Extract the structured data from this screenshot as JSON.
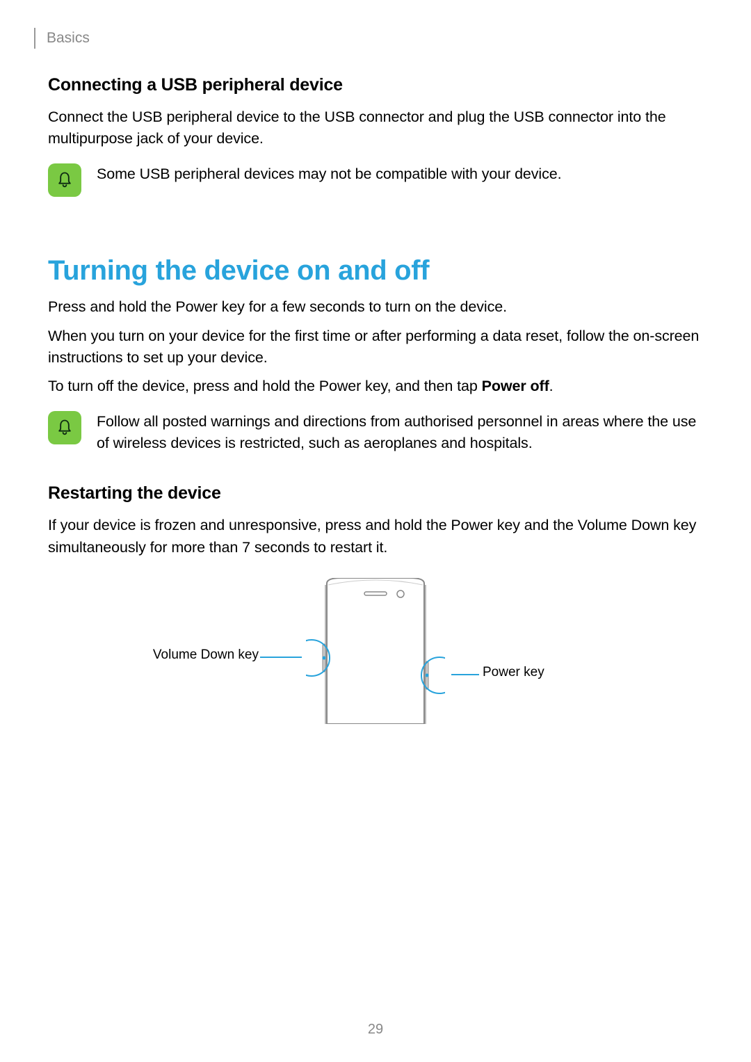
{
  "header": {
    "section": "Basics"
  },
  "usb": {
    "heading": "Connecting a USB peripheral device",
    "body": "Connect the USB peripheral device to the USB connector and plug the USB connector into the multipurpose jack of your device.",
    "note": "Some USB peripheral devices may not be compatible with your device."
  },
  "turning": {
    "heading": "Turning the device on and off",
    "p1": "Press and hold the Power key for a few seconds to turn on the device.",
    "p2": "When you turn on your device for the first time or after performing a data reset, follow the on-screen instructions to set up your device.",
    "p3_pre": "To turn off the device, press and hold the Power key, and then tap ",
    "p3_bold": "Power off",
    "p3_post": ".",
    "note": "Follow all posted warnings and directions from authorised personnel in areas where the use of wireless devices is restricted, such as aeroplanes and hospitals."
  },
  "restarting": {
    "heading": "Restarting the device",
    "body": "If your device is frozen and unresponsive, press and hold the Power key and the Volume Down key simultaneously for more than 7 seconds to restart it."
  },
  "diagram": {
    "left_label": "Volume Down key",
    "right_label": "Power key"
  },
  "page_number": "29"
}
